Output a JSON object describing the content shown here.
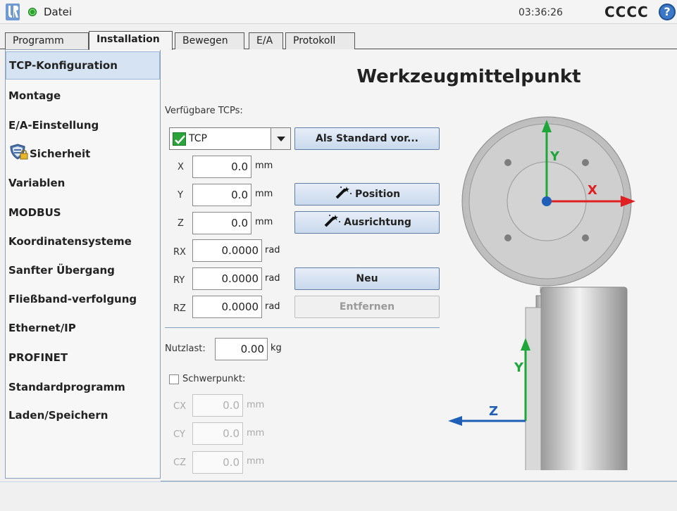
{
  "topbar": {
    "file_label": "Datei",
    "clock": "03:36:26",
    "robot_name": "CCCC",
    "help_symbol": "?"
  },
  "tabs": [
    {
      "label": "Programm",
      "active": false
    },
    {
      "label": "Installation",
      "active": true
    },
    {
      "label": "Bewegen",
      "active": false
    },
    {
      "label": "E/A",
      "active": false
    },
    {
      "label": "Protokoll",
      "active": false
    }
  ],
  "sidebar": {
    "items": [
      {
        "label": "TCP-Konfiguration",
        "selected": true
      },
      {
        "label": "Montage"
      },
      {
        "label": "E/A-Einstellung"
      },
      {
        "label": "Sicherheit",
        "icon": "shield-lock-icon"
      },
      {
        "label": "Variablen"
      },
      {
        "label": "MODBUS"
      },
      {
        "label": "Koordinatensysteme"
      },
      {
        "label": "Sanfter Übergang"
      },
      {
        "label": "Fließband-verfolgung"
      },
      {
        "label": "Ethernet/IP"
      },
      {
        "label": "PROFINET"
      },
      {
        "label": "Standardprogramm"
      },
      {
        "label": "Laden/Speichern"
      }
    ]
  },
  "main": {
    "title": "Werkzeugmittelpunkt",
    "available_label": "Verfügbare TCPs:",
    "tcp_select": "TCP",
    "set_default_button": "Als Standard vor...",
    "coords": [
      {
        "label": "X",
        "value": "0.0",
        "unit": "mm"
      },
      {
        "label": "Y",
        "value": "0.0",
        "unit": "mm"
      },
      {
        "label": "Z",
        "value": "0.0",
        "unit": "mm"
      },
      {
        "label": "RX",
        "value": "0.0000",
        "unit": "rad"
      },
      {
        "label": "RY",
        "value": "0.0000",
        "unit": "rad"
      },
      {
        "label": "RZ",
        "value": "0.0000",
        "unit": "rad"
      }
    ],
    "position_button": "Position",
    "orientation_button": "Ausrichtung",
    "new_button": "Neu",
    "remove_button": "Entfernen",
    "payload_label": "Nutzlast:",
    "payload_value": "0.00",
    "payload_unit": "kg",
    "cog_label": "Schwerpunkt:",
    "cog": [
      {
        "label": "CX",
        "value": "0.0",
        "unit": "mm"
      },
      {
        "label": "CY",
        "value": "0.0",
        "unit": "mm"
      },
      {
        "label": "CZ",
        "value": "0.0",
        "unit": "mm"
      }
    ],
    "axis_labels": {
      "top_y": "Y",
      "top_x": "X",
      "side_y": "Y",
      "side_z": "Z"
    }
  },
  "colors": {
    "axis_x": "#e02020",
    "axis_y": "#1ea63a",
    "axis_z": "#1f5fb8",
    "selected": "#d5e3f2"
  }
}
